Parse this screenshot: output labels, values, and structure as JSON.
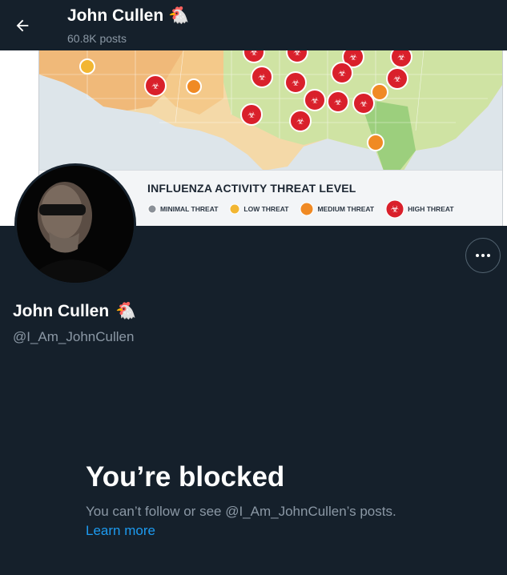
{
  "header": {
    "title": "John Cullen",
    "emoji": "🐔",
    "posts_count": "60.8K posts"
  },
  "banner": {
    "legend_title": "INFLUENZA ACTIVITY THREAT LEVEL",
    "legend_items": [
      "MINIMAL THREAT",
      "LOW THREAT",
      "MEDIUM THREAT",
      "HIGH THREAT"
    ],
    "colors": {
      "minimal": "#8a9097",
      "low": "#f2b632",
      "medium": "#f08a24",
      "high": "#d9202b"
    }
  },
  "profile": {
    "name": "John Cullen",
    "emoji": "🐔",
    "handle": "@I_Am_JohnCullen"
  },
  "blocked": {
    "title": "You’re blocked",
    "description": "You can’t follow or see @I_Am_JohnCullen’s posts.",
    "learn_more": "Learn more"
  },
  "icons": {
    "back": "arrow-left-icon",
    "more": "more-options-icon"
  },
  "theme": {
    "background": "#15202b",
    "secondary_text": "#8b98a5",
    "link": "#1d9bf0"
  }
}
